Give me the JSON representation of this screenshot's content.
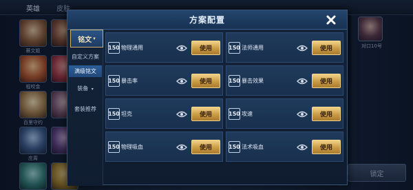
{
  "background": {
    "tabs": [
      "英雄",
      "皮肤"
    ],
    "hero_names": [
      "蔡文姬",
      "程咬金",
      "百里守约",
      "庄周"
    ],
    "right_hero_label": "对口10号",
    "bottom_button": "锁定"
  },
  "modal": {
    "title": "方案配置",
    "close_icon": "close-icon",
    "sidebar": {
      "main_tab": "铭文",
      "items": [
        "自定义方案",
        "满级铭文",
        "装备",
        "套装推荐"
      ]
    },
    "presets": [
      {
        "level": "150",
        "name": "物理通用",
        "button": "使用"
      },
      {
        "level": "150",
        "name": "法师通用",
        "button": "使用"
      },
      {
        "level": "150",
        "name": "暴击率",
        "button": "使用"
      },
      {
        "level": "150",
        "name": "暴击效果",
        "button": "使用"
      },
      {
        "level": "150",
        "name": "坦克",
        "button": "使用"
      },
      {
        "level": "150",
        "name": "攻速",
        "button": "使用"
      },
      {
        "level": "150",
        "name": "物理吸血",
        "button": "使用"
      },
      {
        "level": "150",
        "name": "法术吸血",
        "button": "使用"
      }
    ]
  },
  "colors": {
    "accent_gold": "#d1b06a",
    "panel_blue": "#1f3a5c",
    "selected_blue": "#2b5d96"
  }
}
